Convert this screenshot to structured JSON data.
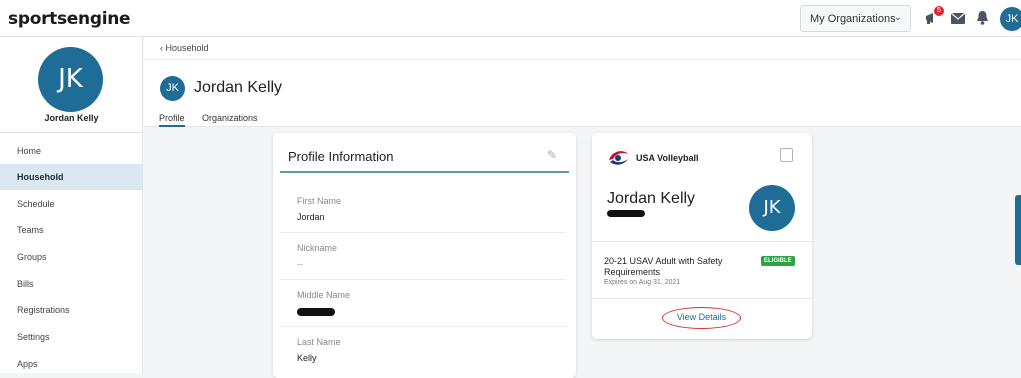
{
  "header": {
    "logo": "sportsengine",
    "org_menu_label": "My Organizations",
    "notification_count": "5",
    "user_initials": "JK"
  },
  "sidebar": {
    "initials": "JK",
    "name": "Jordan Kelly",
    "items": [
      {
        "label": "Home"
      },
      {
        "label": "Household"
      },
      {
        "label": "Schedule"
      },
      {
        "label": "Teams"
      },
      {
        "label": "Groups"
      },
      {
        "label": "Bills"
      },
      {
        "label": "Registrations"
      },
      {
        "label": "Settings"
      },
      {
        "label": "Apps"
      }
    ],
    "active_item": "Household"
  },
  "main": {
    "breadcrumb": "Household",
    "avatar_initials": "JK",
    "person_name": "Jordan Kelly",
    "tabs": [
      {
        "label": "Profile"
      },
      {
        "label": "Organizations"
      }
    ],
    "active_tab": "Profile"
  },
  "profile_card": {
    "title": "Profile Information",
    "fields": [
      {
        "label": "First Name",
        "value": "Jordan"
      },
      {
        "label": "Nickname",
        "value": "--"
      },
      {
        "label": "Middle Name",
        "value": ""
      },
      {
        "label": "Last Name",
        "value": "Kelly"
      }
    ]
  },
  "eligibility_card": {
    "org_name": "USA Volleyball",
    "person_name": "Jordan Kelly",
    "initials": "JK",
    "membership": "20-21 USAV Adult with Safety Requirements",
    "status": "ELIGIBLE",
    "expires": "Expires on Aug 31, 2021",
    "action_label": "View Details"
  },
  "colors": {
    "brand_blue": "#1f6c97",
    "eligible_green": "#2aa544",
    "active_nav_bg": "#dbe8f1",
    "annotation_red": "#d32f2f"
  }
}
